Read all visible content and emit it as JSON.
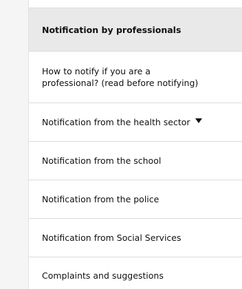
{
  "menu": {
    "items": [
      {
        "label": "Notification by professionals"
      },
      {
        "label_line1": "How to notify if you are a",
        "label_line2": "professional? (read before notifying)"
      },
      {
        "label": "Notification from the health sector"
      },
      {
        "label": "Notification from the school"
      },
      {
        "label": "Notification from the police"
      },
      {
        "label": "Notification from Social Services"
      },
      {
        "label": "Complaints and suggestions"
      }
    ],
    "caret_icon": "caret-down-icon"
  }
}
